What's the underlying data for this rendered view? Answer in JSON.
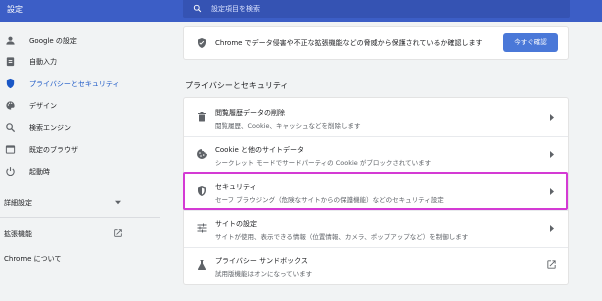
{
  "header": {
    "title": "設定",
    "search_placeholder": "設定項目を検索"
  },
  "sidebar": {
    "items": [
      {
        "label": "Google の設定",
        "icon": "person-icon",
        "active": false
      },
      {
        "label": "自動入力",
        "icon": "clipboard-icon",
        "active": false
      },
      {
        "label": "プライバシーとセキュリティ",
        "icon": "shield-icon",
        "active": true
      },
      {
        "label": "デザイン",
        "icon": "palette-icon",
        "active": false
      },
      {
        "label": "検索エンジン",
        "icon": "search-icon",
        "active": false
      },
      {
        "label": "既定のブラウザ",
        "icon": "browser-icon",
        "active": false
      },
      {
        "label": "起動時",
        "icon": "power-icon",
        "active": false
      }
    ],
    "advanced_label": "詳細設定",
    "extensions_label": "拡張機能",
    "about_label": "Chrome について"
  },
  "safety_check": {
    "text": "Chrome でデータ侵害や不正な拡張機能などの脅威から保護されているか確認します",
    "button_label": "今すぐ確認"
  },
  "privacy_section": {
    "title": "プライバシーとセキュリティ",
    "rows": [
      {
        "title": "閲覧履歴データの削除",
        "desc": "閲覧履歴、Cookie、キャッシュなどを削除します",
        "icon": "trash-icon",
        "action": "arrow"
      },
      {
        "title": "Cookie と他のサイトデータ",
        "desc": "シークレット モードでサードパーティの Cookie がブロックされています",
        "icon": "cookie-icon",
        "action": "arrow"
      },
      {
        "title": "セキュリティ",
        "desc": "セーフ ブラウジング（危険なサイトからの保護機能）などのセキュリティ設定",
        "icon": "security-shield-icon",
        "action": "arrow"
      },
      {
        "title": "サイトの設定",
        "desc": "サイトが使用、表示できる情報（位置情報、カメラ、ポップアップなど）を制御します",
        "icon": "sliders-icon",
        "action": "arrow"
      },
      {
        "title": "プライバシー サンドボックス",
        "desc": "試用版機能はオンになっています",
        "icon": "flask-icon",
        "action": "external"
      }
    ]
  },
  "colors": {
    "header_bg": "#3c5ec6",
    "accent": "#1a57c6",
    "button_bg": "#4a78d8",
    "highlight_border": "#d43ad4"
  }
}
